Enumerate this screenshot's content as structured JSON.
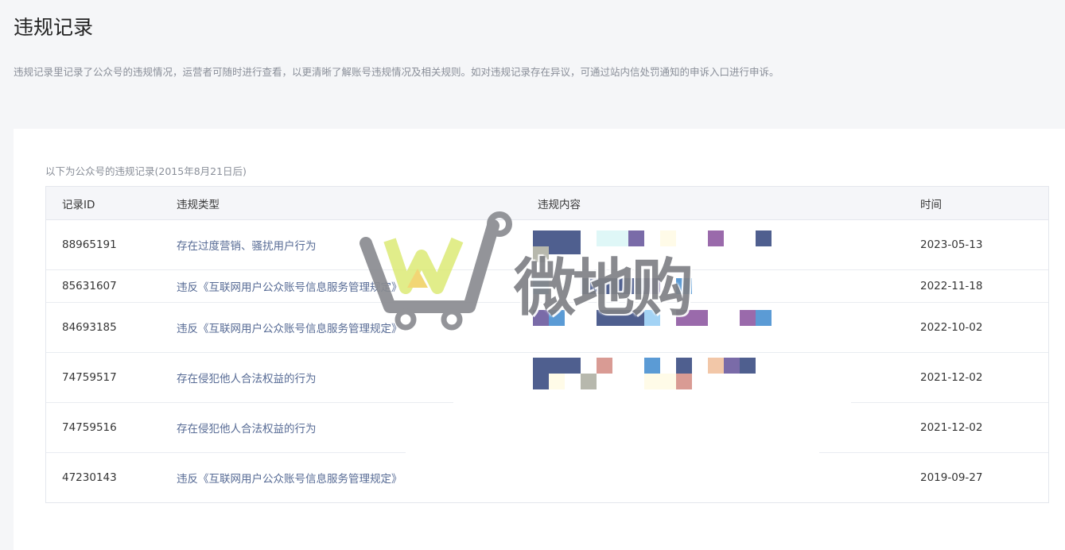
{
  "page": {
    "title": "违规记录",
    "description": "违规记录里记录了公众号的违规情况，运营者可随时进行查看，以更清晰了解账号违规情况及相关规则。如对违规记录存在异议，可通过站内信处罚通知的申诉入口进行申诉。"
  },
  "records": {
    "caption": "以下为公众号的违规记录(2015年8月21日后)",
    "headers": {
      "id": "记录ID",
      "type": "违规类型",
      "content": "违规内容",
      "time": "时间"
    },
    "rows": [
      {
        "id": "88965191",
        "type": "存在过度营销、骚扰用户行为",
        "time": "2023-05-13"
      },
      {
        "id": "85631607",
        "type": "违反《互联网用户公众账号信息服务管理规定》",
        "time": "2022-11-18"
      },
      {
        "id": "84693185",
        "type": "违反《互联网用户公众账号信息服务管理规定》",
        "time": "2022-10-02"
      },
      {
        "id": "74759517",
        "type": "存在侵犯他人合法权益的行为",
        "time": "2021-12-02"
      },
      {
        "id": "74759516",
        "type": "存在侵犯他人合法权益的行为",
        "time": "2021-12-02"
      },
      {
        "id": "47230143",
        "type": "违反《互联网用户公众账号信息服务管理规定》",
        "time": "2019-09-27"
      }
    ]
  },
  "watermark": {
    "text": "微地购",
    "icon": "shopping-cart-logo-icon"
  },
  "colors": {
    "page_bg": "#f5f6f8",
    "link": "#576b95",
    "mosaic": [
      "#4f5f8f",
      "#7a6ba8",
      "#9a6aab",
      "#d99b94",
      "#5b9bd5",
      "#f2c7a8",
      "#b7b8ad",
      "#a3d3f5",
      "#dff7f7",
      "#fffbe8"
    ]
  }
}
